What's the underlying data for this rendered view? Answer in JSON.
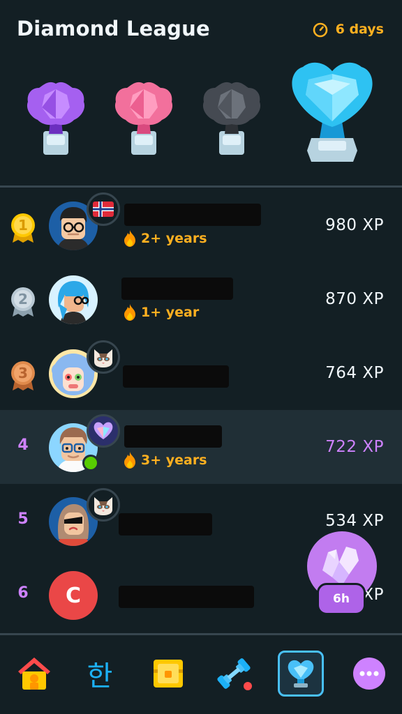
{
  "header": {
    "title": "Diamond League",
    "timer_icon": "stopwatch-icon",
    "timer_text": "6 days"
  },
  "league_trophies": [
    {
      "name": "amethyst-trophy",
      "color": "#a560f0"
    },
    {
      "name": "pearl-trophy",
      "color": "#f2709c"
    },
    {
      "name": "obsidian-trophy",
      "color": "#555a62"
    },
    {
      "name": "diamond-trophy",
      "color": "#4fd0f5",
      "current": true
    }
  ],
  "leaderboard": {
    "rows": [
      {
        "rank": "1",
        "xp": "980 XP",
        "streak": "2+ years",
        "flair": "norway-flag-icon",
        "medal": "gold"
      },
      {
        "rank": "2",
        "xp": "870 XP",
        "streak": "1+ year",
        "flair": "",
        "medal": "silver"
      },
      {
        "rank": "3",
        "xp": "764 XP",
        "streak": "",
        "flair": "cat-icon",
        "medal": "bronze"
      },
      {
        "rank": "4",
        "xp": "722 XP",
        "streak": "3+ years",
        "flair": "diamond-icon",
        "current_user": true
      },
      {
        "rank": "5",
        "xp": "534 XP",
        "streak": "",
        "flair": "cat-icon"
      },
      {
        "rank": "6",
        "xp": "XP",
        "streak": "",
        "avatar_letter": "C"
      }
    ]
  },
  "chest_timer": "6h",
  "nav": {
    "items": [
      {
        "name": "home",
        "icon": "house-icon"
      },
      {
        "name": "alphabet",
        "label": "한"
      },
      {
        "name": "quests",
        "icon": "chest-icon"
      },
      {
        "name": "practice",
        "icon": "dumbbell-icon"
      },
      {
        "name": "leaderboards",
        "icon": "trophy-icon",
        "active": true
      },
      {
        "name": "more",
        "icon": "more-icon"
      }
    ]
  },
  "colors": {
    "background": "#131f24",
    "accent_purple": "#ce82ff",
    "streak_orange": "#ffb020",
    "current_row": "#202f36"
  }
}
